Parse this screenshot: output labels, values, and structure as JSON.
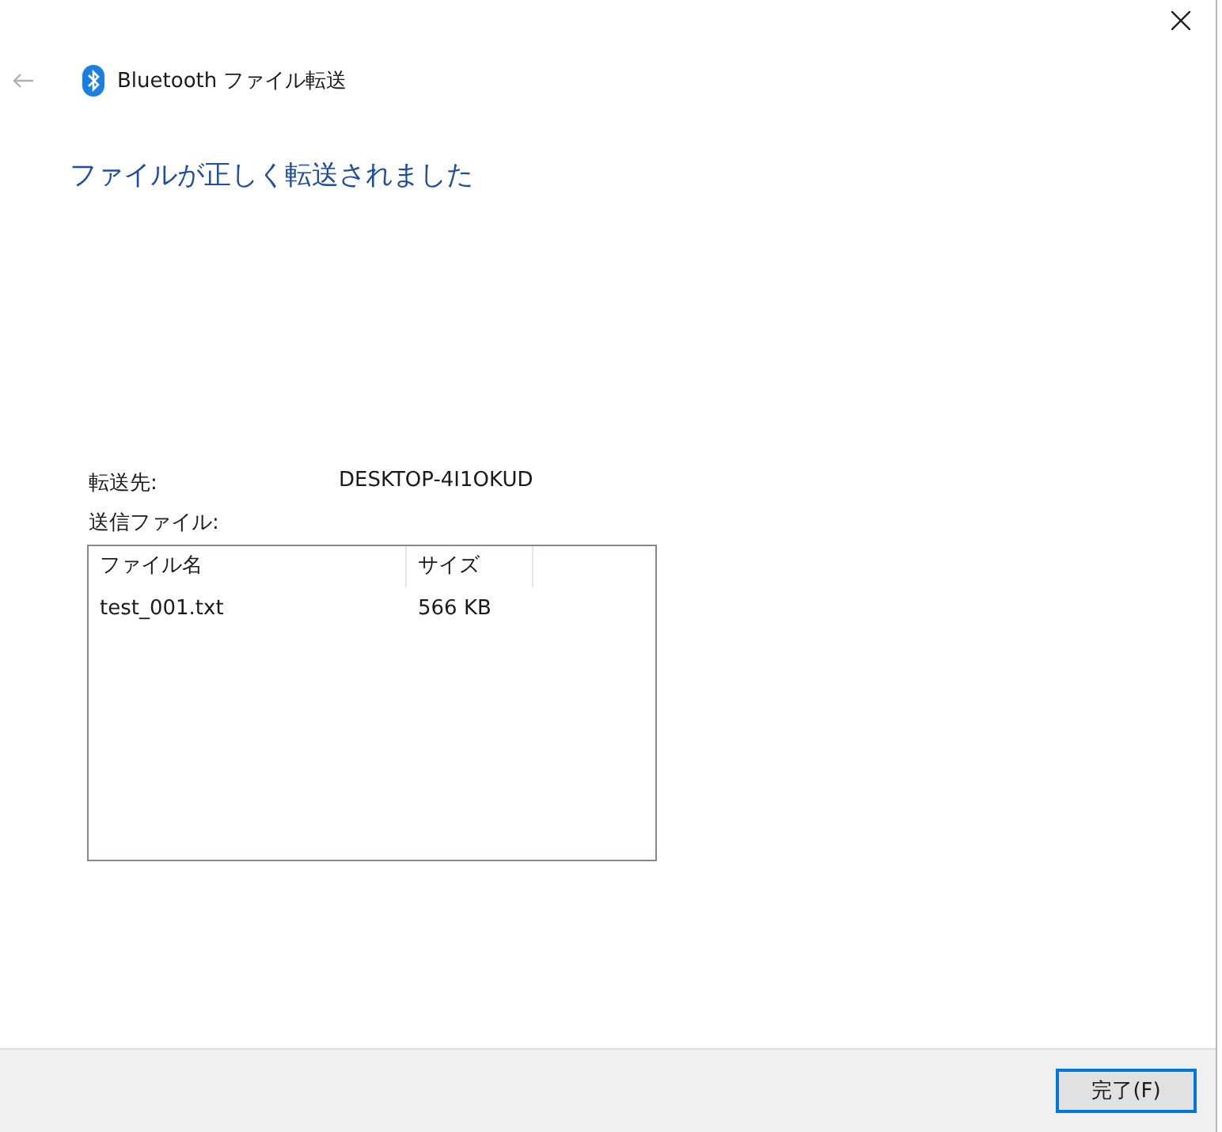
{
  "window": {
    "title": "Bluetooth ファイル転送"
  },
  "heading": "ファイルが正しく転送されました",
  "details": [
    {
      "label": "転送先:",
      "value": "DESKTOP-4I1OKUD"
    }
  ],
  "files_label": "送信ファイル:",
  "table": {
    "columns": [
      "ファイル名",
      "サイズ"
    ],
    "rows": [
      [
        "test_001.txt",
        "566 KB"
      ]
    ]
  },
  "buttons": [
    "完了(F)"
  ]
}
